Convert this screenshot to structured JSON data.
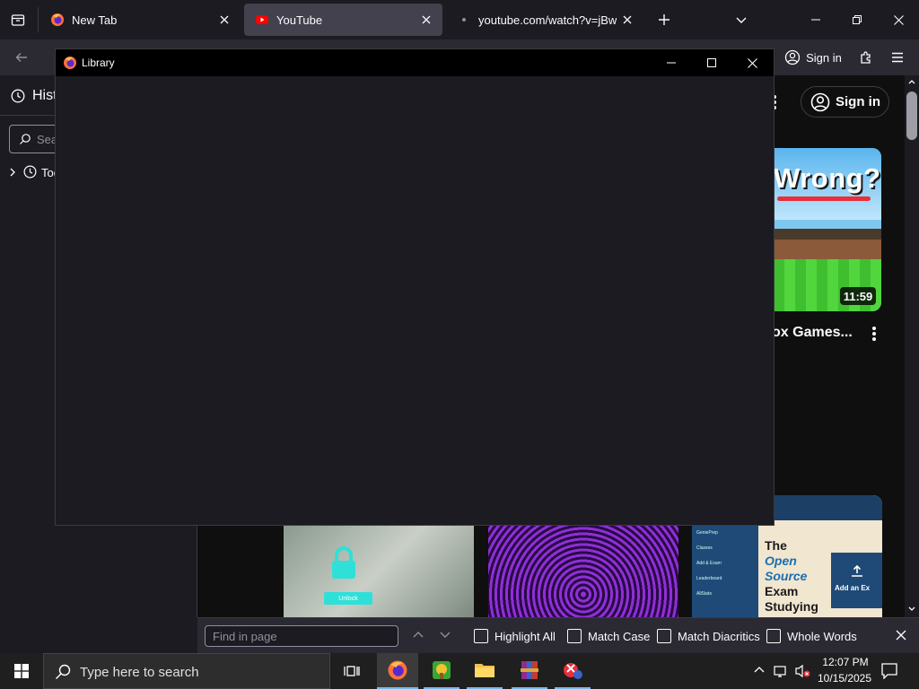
{
  "tabs": [
    {
      "label": "New Tab",
      "active": false
    },
    {
      "label": "YouTube",
      "active": true
    },
    {
      "label": "youtube.com/watch?v=jBwHUv",
      "active": false
    }
  ],
  "navbar": {
    "sign_in_label": "Sign in"
  },
  "sidebar": {
    "title": "Hist",
    "search_placeholder": "Sear",
    "today_label": "Tod"
  },
  "youtube": {
    "sign_in_label": "Sign in",
    "thumb_text": "Wrong?",
    "duration": "11:59",
    "video_title": "ox Games...",
    "study_lines": [
      "The",
      "Open",
      "Source",
      "Exam",
      "Studying"
    ],
    "add_exam": "Add an Ex",
    "menu_items": [
      "GeniePrep",
      "Classes",
      "Add & Exam",
      "Leaderboard",
      "AllStats"
    ],
    "unlock_label": "Unlock"
  },
  "findbar": {
    "placeholder": "Find in page",
    "highlight_all": "Highlight All",
    "match_case": "Match Case",
    "match_diacritics": "Match Diacritics",
    "whole_words": "Whole Words"
  },
  "taskbar": {
    "search_placeholder": "Type here to search",
    "time": "12:07 PM",
    "date": "10/15/2025"
  },
  "library": {
    "title": "Library"
  },
  "colors": {
    "accent_blue": "#0078d4",
    "youtube_red": "#ff0000",
    "dark_bg": "#1c1b22",
    "toolbar": "#2b2a33"
  }
}
